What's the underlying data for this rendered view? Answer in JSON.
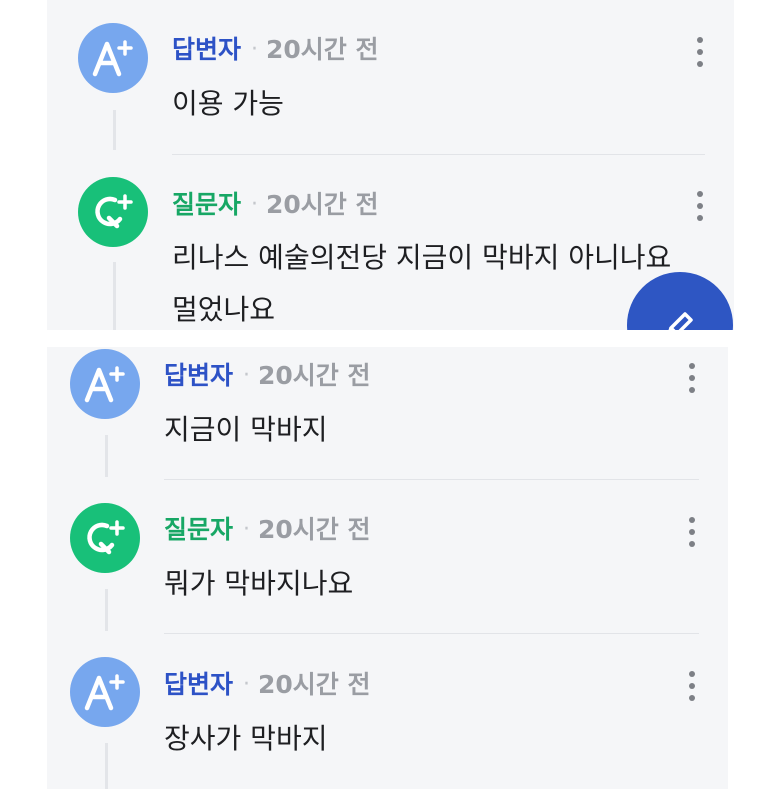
{
  "top_panel": {
    "entries": [
      {
        "role": "답변자",
        "separator": "·",
        "time": "20시간 전",
        "lines": [
          "이용 가능"
        ]
      },
      {
        "role": "질문자",
        "separator": "·",
        "time": "20시간 전",
        "lines": [
          "리나스 예술의전당 지금이 막바지 아니나요",
          "멀었나요"
        ]
      }
    ]
  },
  "bottom_panel": {
    "entries": [
      {
        "role": "답변자",
        "separator": "·",
        "time": "20시간 전",
        "lines": [
          "지금이 막바지"
        ]
      },
      {
        "role": "질문자",
        "separator": "·",
        "time": "20시간 전",
        "lines": [
          "뭐가 막바지나요"
        ]
      },
      {
        "role": "답변자",
        "separator": "·",
        "time": "20시간 전",
        "lines": [
          "장사가 막바지"
        ]
      }
    ]
  },
  "icons": {
    "answerer_avatar": "a-plus-icon",
    "asker_avatar": "q-plus-icon",
    "more": "more-vertical-icon",
    "fab": "pencil-icon"
  },
  "colors": {
    "answerer_role": "#2d52c6",
    "asker_role": "#17a765",
    "answerer_avatar": "#77a7ee",
    "asker_avatar": "#18c079",
    "fab": "#2e56c3",
    "panel_bg": "#f5f6f8"
  }
}
